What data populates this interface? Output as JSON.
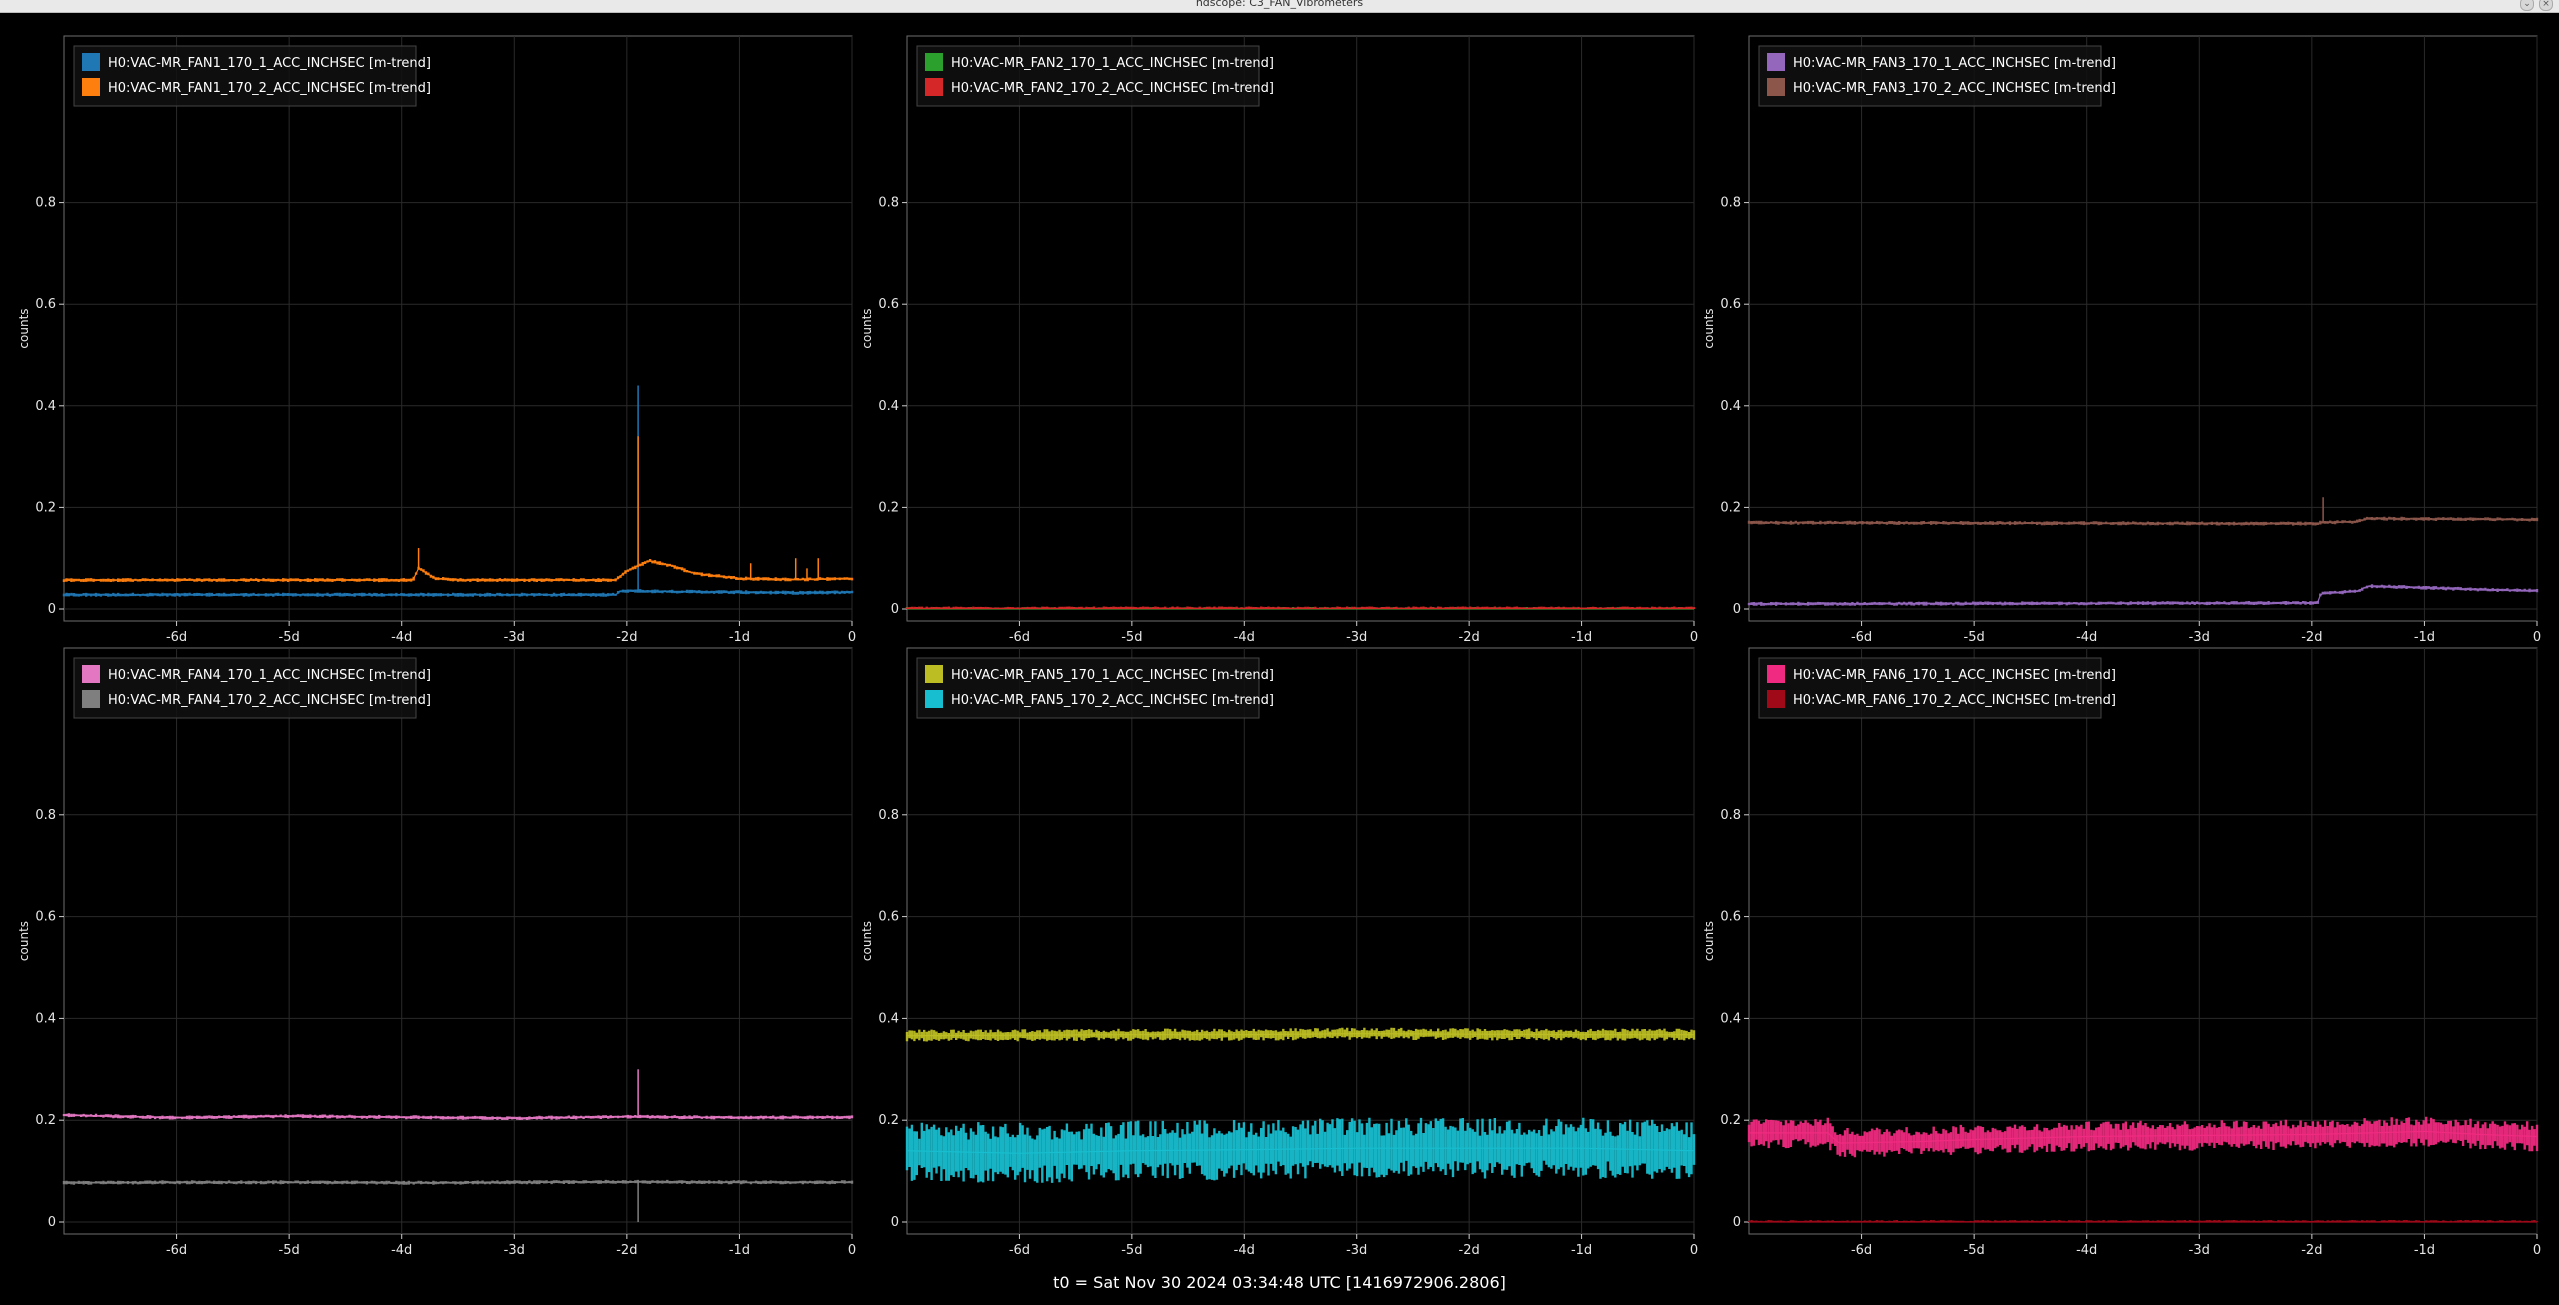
{
  "window": {
    "title": "ndscope: C3_FAN_Vibrometers",
    "buttons": [
      "chevron-down",
      "close"
    ]
  },
  "footer": {
    "t0": "t0 = Sat Nov 30 2024 03:34:48 UTC [1416972906.2806]"
  },
  "chart_data": [
    {
      "type": "line",
      "ylabel": "counts",
      "ylim": [
        0,
        1
      ],
      "yticks": [
        0,
        0.2,
        0.4,
        0.6,
        0.8
      ],
      "xlim": [
        -7,
        0
      ],
      "xticks": [
        -6,
        -5,
        -4,
        -3,
        -2,
        -1,
        0
      ],
      "xticklabels": [
        "-6d",
        "-5d",
        "-4d",
        "-3d",
        "-2d",
        "-1d",
        "0"
      ],
      "grid": true,
      "legend": "top-left",
      "series": [
        {
          "name": "H0:VAC-MR_FAN1_170_1_ACC_INCHSEC [m-trend]",
          "color": "#1f77b4",
          "x": [
            -7,
            -2.1,
            -2.09,
            -2.05,
            -1.5,
            -1.0,
            -0.5,
            0
          ],
          "y": [
            0.028,
            0.028,
            0.03,
            0.036,
            0.034,
            0.033,
            0.032,
            0.033
          ],
          "spikes": [
            {
              "x": -1.9,
              "y": 0.44
            }
          ]
        },
        {
          "name": "H0:VAC-MR_FAN1_170_2_ACC_INCHSEC [m-trend]",
          "color": "#ff7f0e",
          "x": [
            -7,
            -3.9,
            -3.85,
            -3.7,
            -3.5,
            -2.1,
            -2.0,
            -1.8,
            -1.6,
            -1.4,
            -1.2,
            -1.0,
            -0.5,
            0
          ],
          "y": [
            0.057,
            0.057,
            0.08,
            0.06,
            0.057,
            0.057,
            0.075,
            0.095,
            0.085,
            0.07,
            0.065,
            0.06,
            0.058,
            0.06
          ],
          "spikes": [
            {
              "x": -3.85,
              "y": 0.12
            },
            {
              "x": -1.9,
              "y": 0.34
            },
            {
              "x": -0.9,
              "y": 0.09
            },
            {
              "x": -0.5,
              "y": 0.1
            },
            {
              "x": -0.4,
              "y": 0.08
            },
            {
              "x": -0.3,
              "y": 0.1
            }
          ]
        }
      ]
    },
    {
      "type": "line",
      "ylabel": "counts",
      "ylim": [
        0,
        1
      ],
      "yticks": [
        0,
        0.2,
        0.4,
        0.6,
        0.8
      ],
      "xlim": [
        -7,
        0
      ],
      "xticks": [
        -6,
        -5,
        -4,
        -3,
        -2,
        -1,
        0
      ],
      "xticklabels": [
        "-6d",
        "-5d",
        "-4d",
        "-3d",
        "-2d",
        "-1d",
        "0"
      ],
      "grid": true,
      "legend": "top-left",
      "series": [
        {
          "name": "H0:VAC-MR_FAN2_170_1_ACC_INCHSEC [m-trend]",
          "color": "#2ca02c",
          "x": [
            -7,
            0
          ],
          "y": [
            0,
            0
          ]
        },
        {
          "name": "H0:VAC-MR_FAN2_170_2_ACC_INCHSEC [m-trend]",
          "color": "#d62728",
          "x": [
            -7,
            0
          ],
          "y": [
            0.001,
            0.001
          ]
        }
      ]
    },
    {
      "type": "line",
      "ylabel": "counts",
      "ylim": [
        0,
        1
      ],
      "yticks": [
        0,
        0.2,
        0.4,
        0.6,
        0.8
      ],
      "xlim": [
        -7,
        0
      ],
      "xticks": [
        -6,
        -5,
        -4,
        -3,
        -2,
        -1,
        0
      ],
      "xticklabels": [
        "-6d",
        "-5d",
        "-4d",
        "-3d",
        "-2d",
        "-1d",
        "0"
      ],
      "grid": true,
      "legend": "top-left",
      "series": [
        {
          "name": "H0:VAC-MR_FAN3_170_1_ACC_INCHSEC [m-trend]",
          "color": "#9467bd",
          "x": [
            -7,
            -1.95,
            -1.92,
            -1.6,
            -1.5,
            -1.0,
            -0.5,
            0
          ],
          "y": [
            0.01,
            0.012,
            0.03,
            0.035,
            0.045,
            0.042,
            0.038,
            0.036
          ]
        },
        {
          "name": "H0:VAC-MR_FAN3_170_2_ACC_INCHSEC [m-trend]",
          "color": "#8c564b",
          "x": [
            -7,
            -1.95,
            -1.92,
            -1.6,
            -1.5,
            0
          ],
          "y": [
            0.17,
            0.168,
            0.17,
            0.172,
            0.178,
            0.176
          ],
          "spikes": [
            {
              "x": -1.9,
              "y": 0.22
            }
          ]
        }
      ]
    },
    {
      "type": "line",
      "ylabel": "counts",
      "ylim": [
        0,
        1
      ],
      "yticks": [
        0,
        0.2,
        0.4,
        0.6,
        0.8
      ],
      "xlim": [
        -7,
        0
      ],
      "xticks": [
        -6,
        -5,
        -4,
        -3,
        -2,
        -1,
        0
      ],
      "xticklabels": [
        "-6d",
        "-5d",
        "-4d",
        "-3d",
        "-2d",
        "-1d",
        "0"
      ],
      "grid": true,
      "legend": "top-left",
      "series": [
        {
          "name": "H0:VAC-MR_FAN4_170_1_ACC_INCHSEC [m-trend]",
          "color": "#e377c2",
          "x": [
            -7,
            -6,
            -5,
            -4,
            -3,
            -2,
            -1,
            0
          ],
          "y": [
            0.21,
            0.205,
            0.208,
            0.206,
            0.204,
            0.207,
            0.205,
            0.206
          ],
          "spikes": [
            {
              "x": -1.9,
              "y": 0.3
            }
          ]
        },
        {
          "name": "H0:VAC-MR_FAN4_170_2_ACC_INCHSEC [m-trend]",
          "color": "#7f7f7f",
          "x": [
            -7,
            -6,
            -5,
            -4,
            -3,
            -2,
            -1,
            0
          ],
          "y": [
            0.077,
            0.078,
            0.078,
            0.077,
            0.078,
            0.079,
            0.078,
            0.078
          ],
          "spikes": [
            {
              "x": -1.9,
              "y": 0.0
            }
          ]
        }
      ]
    },
    {
      "type": "line",
      "ylabel": "counts",
      "ylim": [
        0,
        1
      ],
      "yticks": [
        0,
        0.2,
        0.4,
        0.6,
        0.8
      ],
      "xlim": [
        -7,
        0
      ],
      "xticks": [
        -6,
        -5,
        -4,
        -3,
        -2,
        -1,
        0
      ],
      "xticklabels": [
        "-6d",
        "-5d",
        "-4d",
        "-3d",
        "-2d",
        "-1d",
        "0"
      ],
      "grid": true,
      "legend": "top-left",
      "series": [
        {
          "name": "H0:VAC-MR_FAN5_170_1_ACC_INCHSEC [m-trend]",
          "color": "#bcbd22",
          "x": [
            -7,
            -6,
            -5,
            -4,
            -3,
            -2,
            -1,
            0
          ],
          "y": [
            0.366,
            0.367,
            0.368,
            0.368,
            0.37,
            0.369,
            0.368,
            0.368
          ],
          "band": 0.012
        },
        {
          "name": "H0:VAC-MR_FAN5_170_2_ACC_INCHSEC [m-trend]",
          "color": "#17becf",
          "x": [
            -7,
            -6,
            -5,
            -4,
            -3,
            -2,
            -1,
            0
          ],
          "y": [
            0.14,
            0.135,
            0.14,
            0.142,
            0.145,
            0.145,
            0.145,
            0.14
          ],
          "band": 0.06
        }
      ]
    },
    {
      "type": "line",
      "ylabel": "counts",
      "ylim": [
        0,
        1
      ],
      "yticks": [
        0,
        0.2,
        0.4,
        0.6,
        0.8
      ],
      "xlim": [
        -7,
        0
      ],
      "xticks": [
        -6,
        -5,
        -4,
        -3,
        -2,
        -1,
        0
      ],
      "xticklabels": [
        "-6d",
        "-5d",
        "-4d",
        "-3d",
        "-2d",
        "-1d",
        "0"
      ],
      "grid": true,
      "legend": "top-left",
      "series": [
        {
          "name": "H0:VAC-MR_FAN6_170_1_ACC_INCHSEC [m-trend]",
          "color": "#f02a80",
          "x": [
            -7,
            -6.3,
            -6.2,
            -5.5,
            -5.0,
            -4.0,
            -3.0,
            -2.0,
            -1.5,
            -1.0,
            -0.5,
            0
          ],
          "y": [
            0.175,
            0.175,
            0.155,
            0.158,
            0.162,
            0.168,
            0.17,
            0.172,
            0.175,
            0.178,
            0.172,
            0.168
          ],
          "band": 0.03
        },
        {
          "name": "H0:VAC-MR_FAN6_170_2_ACC_INCHSEC [m-trend]",
          "color": "#a00a18",
          "x": [
            -7,
            0
          ],
          "y": [
            0.0,
            0.0
          ]
        }
      ]
    }
  ]
}
